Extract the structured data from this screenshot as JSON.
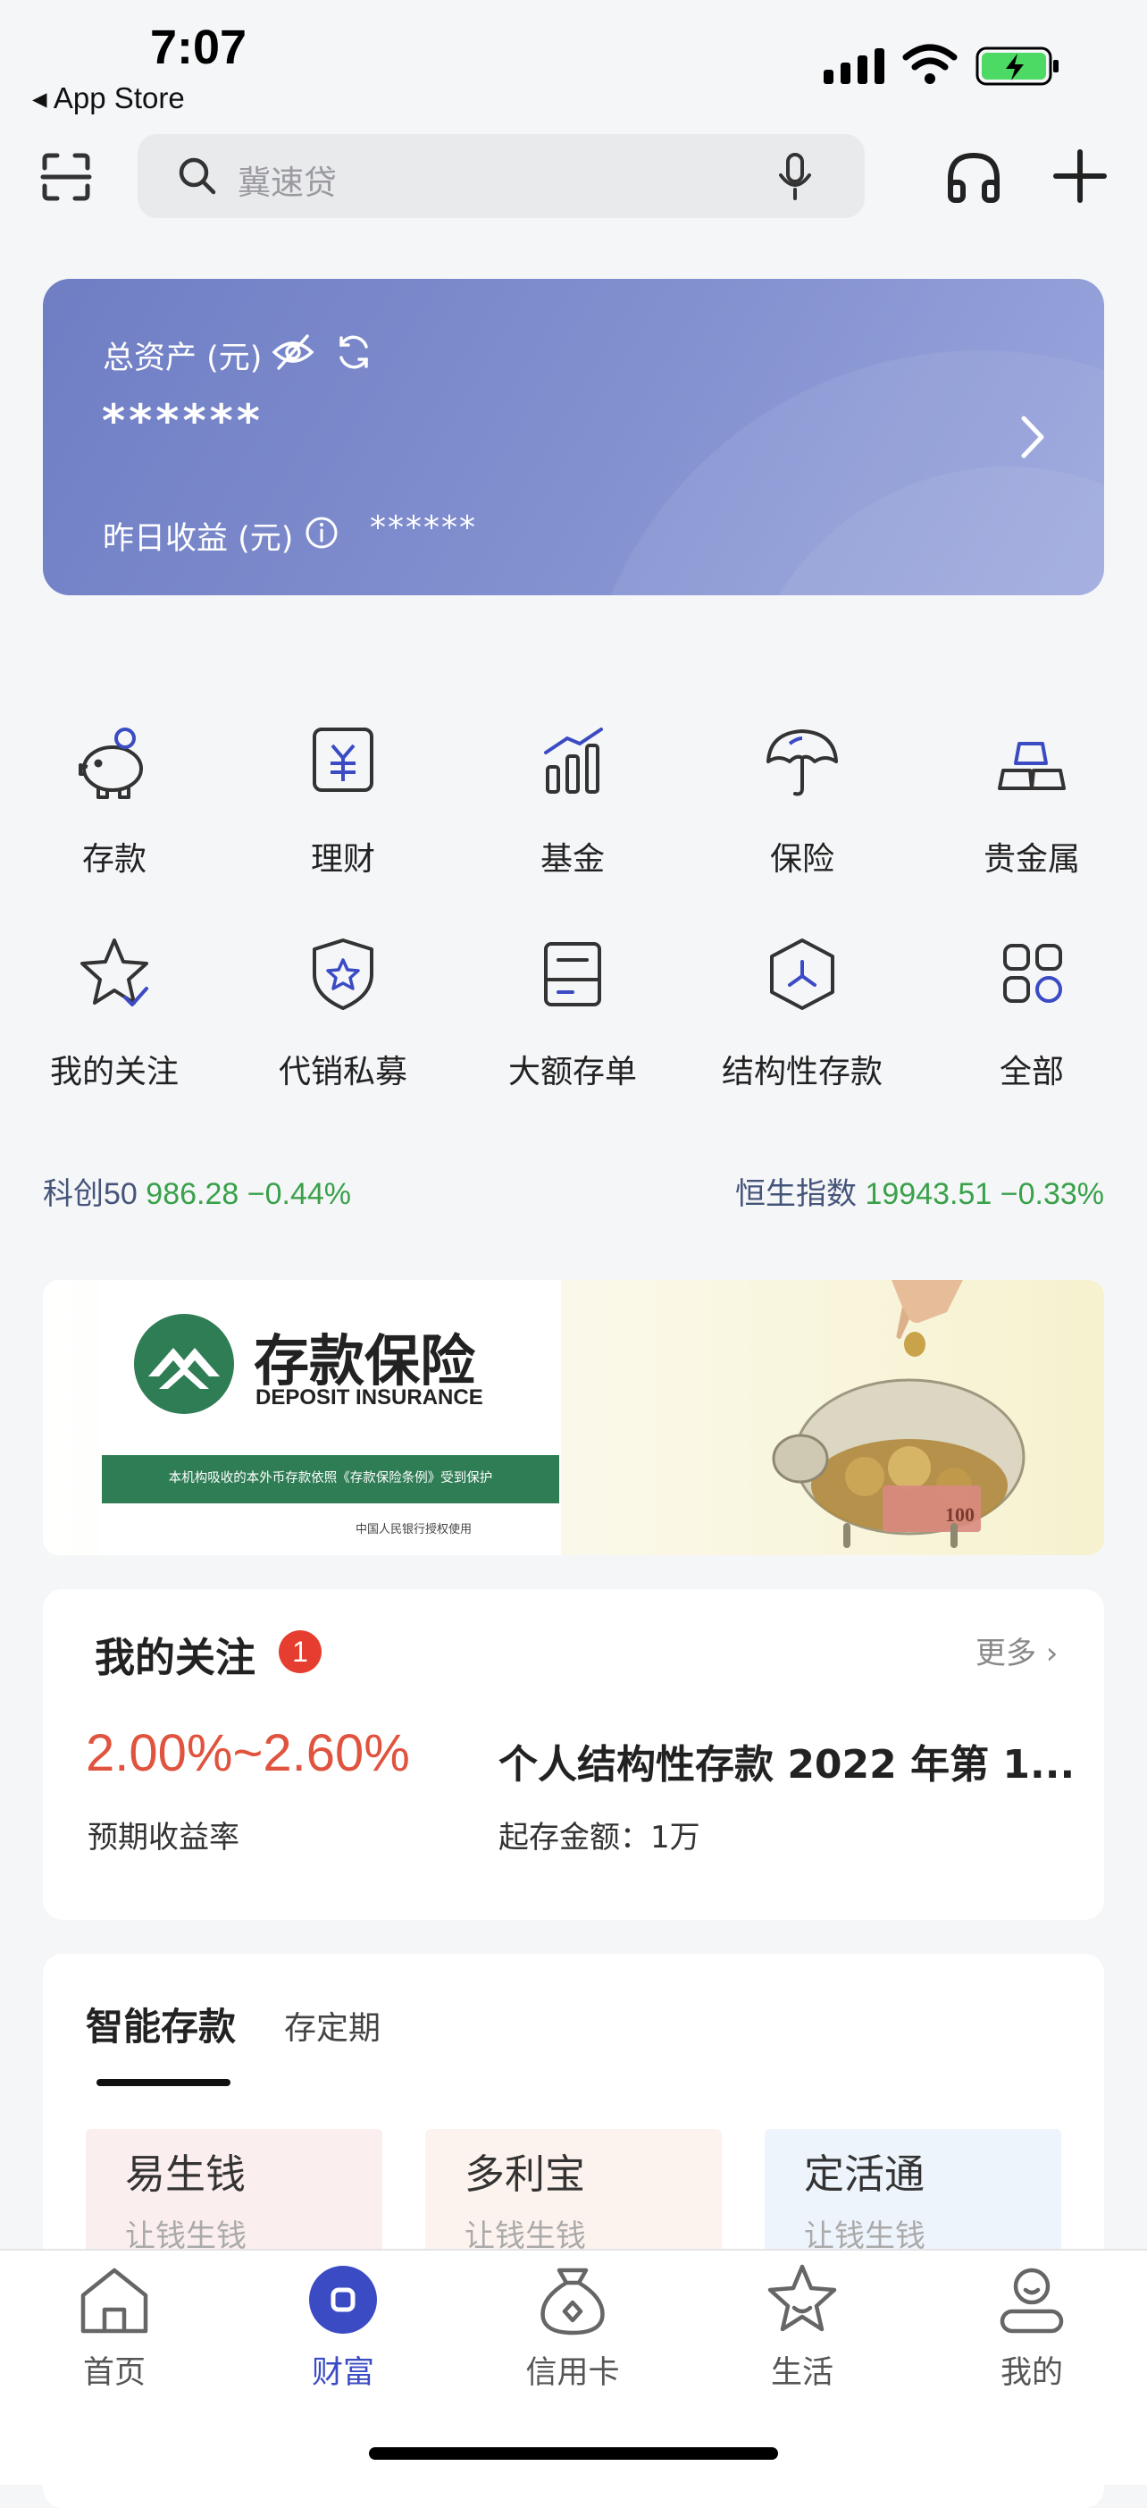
{
  "status": {
    "time": "7:07",
    "back_label": "App Store"
  },
  "search": {
    "placeholder": "冀速贷"
  },
  "assets": {
    "total_label": "总资产 (元)",
    "total_value": "******",
    "yesterday_label": "昨日收益 (元)",
    "yesterday_value": "******"
  },
  "grid": [
    {
      "label": "存款",
      "icon": "piggy-bank-icon"
    },
    {
      "label": "理财",
      "icon": "yuan-card-icon"
    },
    {
      "label": "基金",
      "icon": "bar-chart-icon"
    },
    {
      "label": "保险",
      "icon": "umbrella-icon"
    },
    {
      "label": "贵金属",
      "icon": "gold-bars-icon"
    },
    {
      "label": "我的关注",
      "icon": "star-check-icon"
    },
    {
      "label": "代销私募",
      "icon": "shield-star-icon"
    },
    {
      "label": "大额存单",
      "icon": "certificate-icon"
    },
    {
      "label": "结构性存款",
      "icon": "hexagon-icon"
    },
    {
      "label": "全部",
      "icon": "four-squares-icon"
    }
  ],
  "indices": [
    {
      "name": "科创50",
      "value": "986.28",
      "change": "−0.44%"
    },
    {
      "name": "恒生指数",
      "value": "19943.51",
      "change": "−0.33%"
    }
  ],
  "banner": {
    "title": "存款保险",
    "subtitle": "DEPOSIT INSURANCE",
    "note": "本机构吸收的本外币存款依照《存款保险条例》受到保护",
    "footer": "中国人民银行授权使用",
    "note_value": "100"
  },
  "follow": {
    "title": "我的关注",
    "badge": "1",
    "more": "更多",
    "rate": "2.00%~2.60%",
    "rate_label": "预期收益率",
    "product": "个人结构性存款 2022 年第 1...",
    "min_amount": "起存金额：1万"
  },
  "deposits": {
    "tabs": [
      "智能存款",
      "存定期"
    ],
    "active_tab": 0,
    "products": [
      {
        "name": "易生钱",
        "tagline": "让钱生钱",
        "color": "#fbeeee"
      },
      {
        "name": "多利宝",
        "tagline": "让钱生钱",
        "color": "#fdf3ee"
      },
      {
        "name": "定活通",
        "tagline": "让钱生钱",
        "color": "#eef4fb"
      }
    ]
  },
  "tabbar": [
    {
      "label": "首页",
      "icon": "home-icon"
    },
    {
      "label": "财富",
      "icon": "wealth-icon"
    },
    {
      "label": "信用卡",
      "icon": "credit-bag-icon"
    },
    {
      "label": "生活",
      "icon": "star-icon"
    },
    {
      "label": "我的",
      "icon": "profile-icon"
    }
  ],
  "tabbar_active": 1,
  "colors": {
    "accent": "#3b4bc4",
    "card": "#7f8dcf",
    "up_green": "#3aa14a",
    "rate_red": "#e0533e",
    "badge_red": "#e53d2f"
  }
}
